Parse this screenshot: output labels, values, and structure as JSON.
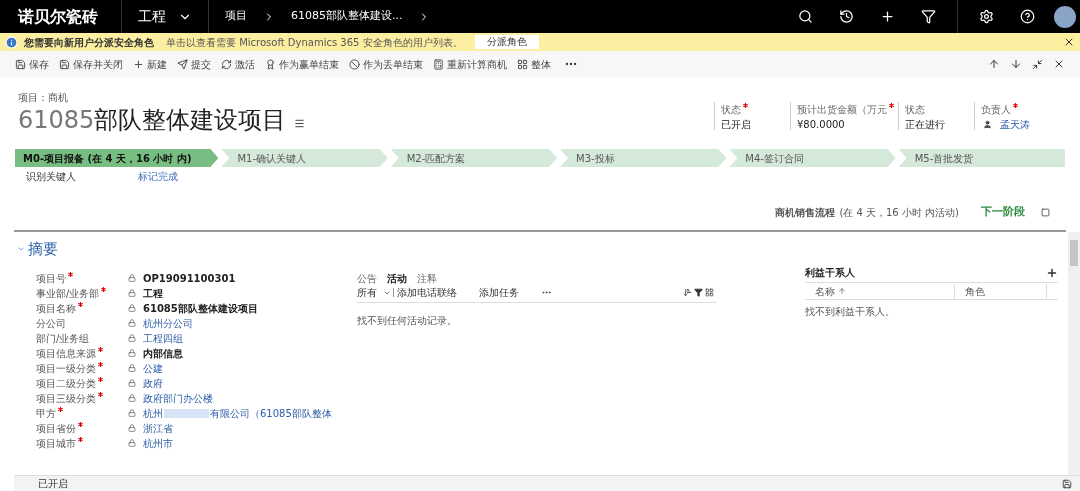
{
  "top_bar": {
    "logo": "诺贝尔瓷砖",
    "module": "工程",
    "breadcrumb": [
      "项目",
      "61085部队整体建设..."
    ]
  },
  "notice": {
    "title": "您需要向新用户分派安全角色",
    "message": "单击以查看需要 Microsoft Dynamics 365 安全角色的用户列表。",
    "button": "分派角色"
  },
  "toolbar": [
    "保存",
    "保存并关闭",
    "新建",
    "提交",
    "激活",
    "作为赢单结束",
    "作为丢单结束",
    "重新计算商机",
    "整体"
  ],
  "record": {
    "entity": "项目：商机",
    "title_number": "61085",
    "title_text": "部队整体建设项目"
  },
  "header_fields": [
    {
      "label": "状态",
      "required": true,
      "value": "已开启",
      "kind": "text"
    },
    {
      "label": "预计出货金额（万元",
      "required": true,
      "value": "¥80.0000",
      "kind": "text"
    },
    {
      "label": "状态",
      "required": false,
      "value": "正在进行",
      "kind": "text"
    },
    {
      "label": "负责人",
      "required": true,
      "value": "孟天涛",
      "kind": "user"
    }
  ],
  "stages": [
    {
      "label": "M0-项目报备 (在 4 天，16 小时 内)",
      "selected": true
    },
    {
      "label": "M1-确认关键人",
      "selected": false
    },
    {
      "label": "M2-匹配方案",
      "selected": false
    },
    {
      "label": "M3-投标",
      "selected": false
    },
    {
      "label": "M4-签订合同",
      "selected": false
    },
    {
      "label": "M5-首批发货",
      "selected": false
    }
  ],
  "stage_step": {
    "label": "识别关键人",
    "action": "标记完成"
  },
  "process": {
    "name": "商机销售流程",
    "duration": "(在 4 天，16 小时 内活动)",
    "next": "下一阶段"
  },
  "section": {
    "title": "摘要"
  },
  "fields": [
    {
      "label": "项目号",
      "required": true,
      "value": "OP19091100301",
      "kind": "text"
    },
    {
      "label": "事业部/业务部",
      "required": true,
      "value": "工程",
      "kind": "text"
    },
    {
      "label": "项目名称",
      "required": true,
      "value": "61085部队整体建设项目",
      "kind": "text"
    },
    {
      "label": "分公司",
      "required": false,
      "value": "杭州分公司",
      "kind": "link"
    },
    {
      "label": "部门/业务组",
      "required": false,
      "value": "工程四组",
      "kind": "link"
    },
    {
      "label": "项目信息来源",
      "required": true,
      "value": "内部信息",
      "kind": "text"
    },
    {
      "label": "项目一级分类",
      "required": true,
      "value": "公建",
      "kind": "link"
    },
    {
      "label": "项目二级分类",
      "required": true,
      "value": "政府",
      "kind": "link"
    },
    {
      "label": "项目三级分类",
      "required": true,
      "value": "政府部门办公楼",
      "kind": "link"
    },
    {
      "label": "甲方",
      "required": true,
      "value": "杭州",
      "value_rest": "有限公司（61085部队整体",
      "kind": "redacted"
    },
    {
      "label": "项目省份",
      "required": true,
      "value": "浙江省",
      "kind": "link"
    },
    {
      "label": "项目城市",
      "required": true,
      "value": "杭州市",
      "kind": "link"
    }
  ],
  "activity": {
    "tabs": [
      {
        "label": "公告",
        "selected": false
      },
      {
        "label": "活动",
        "selected": true
      },
      {
        "label": "注释",
        "selected": false
      }
    ],
    "filter": "所有",
    "actions": [
      "添加电话联络",
      "添加任务"
    ],
    "empty": "找不到任何活动记录。"
  },
  "stakeholders": {
    "title": "利益干系人",
    "columns": [
      "名称",
      "角色"
    ],
    "empty": "找不到利益干系人。"
  },
  "status_bar": {
    "text": "已开启"
  }
}
